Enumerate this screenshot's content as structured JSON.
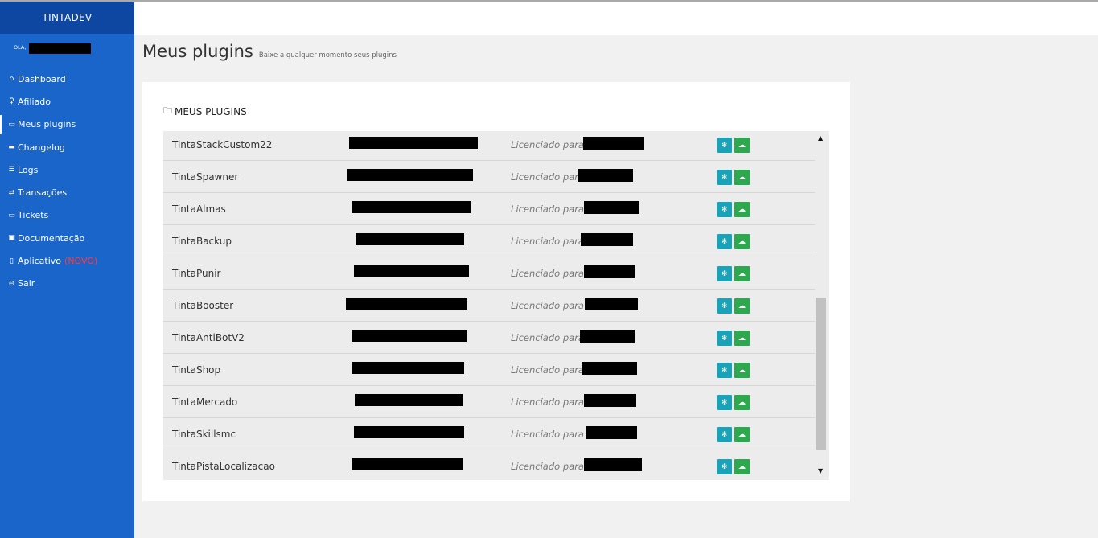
{
  "sidebar": {
    "brand": "TINTADEV",
    "greeting": "OLÁ,",
    "items": [
      {
        "label": "Dashboard",
        "icon": "dashboard-icon"
      },
      {
        "label": "Afiliado",
        "icon": "lightbulb-icon"
      },
      {
        "label": "Meus plugins",
        "icon": "archive-icon"
      },
      {
        "label": "Changelog",
        "icon": "window-icon"
      },
      {
        "label": "Logs",
        "icon": "list-icon"
      },
      {
        "label": "Transações",
        "icon": "shuffle-icon"
      },
      {
        "label": "Tickets",
        "icon": "ticket-icon"
      },
      {
        "label": "Documentação",
        "icon": "briefcase-icon"
      },
      {
        "label": "Aplicativo",
        "icon": "mobile-icon",
        "badge": "(NOVO)"
      },
      {
        "label": "Sair",
        "icon": "logout-icon"
      }
    ],
    "active_index": 2
  },
  "page": {
    "title": "Meus plugins",
    "subtitle": "Baixe a qualquer momento seus plugins"
  },
  "panel": {
    "title": "MEUS PLUGINS",
    "icon": "folder-icon"
  },
  "table": {
    "license_label": "Licenciado para",
    "rows": [
      {
        "name": "TintaStackCustom22"
      },
      {
        "name": "TintaSpawner"
      },
      {
        "name": "TintaAlmas"
      },
      {
        "name": "TintaBackup"
      },
      {
        "name": "TintaPunir"
      },
      {
        "name": "TintaBooster"
      },
      {
        "name": "TintaAntiBotV2"
      },
      {
        "name": "TintaShop"
      },
      {
        "name": "TintaMercado"
      },
      {
        "name": "TintaSkillsmc"
      },
      {
        "name": "TintaPistaLocalizacao"
      }
    ]
  },
  "colors": {
    "sidebar": "#1a65c9",
    "brand_bar": "#0d47a1",
    "settings_button": "#1aa3b8",
    "download_button": "#2ea84f",
    "badge": "#ff3b3b"
  }
}
